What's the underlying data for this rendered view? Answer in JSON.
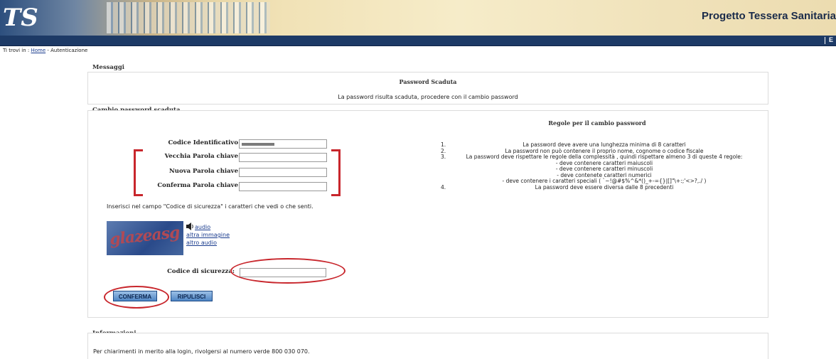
{
  "header": {
    "logo_text": "TS",
    "title": "Progetto Tessera Sanitaria",
    "nav_letter": "E"
  },
  "breadcrumb": {
    "prefix": "Ti trovi in : ",
    "home_link": "Home",
    "current": " - Autenticazione"
  },
  "messages": {
    "section_title": "Messaggi",
    "heading": "Password Scaduta",
    "text": "La password risulta scaduta, procedere con il cambio password"
  },
  "change_password": {
    "section_title": "Cambio password scaduta",
    "fields": {
      "codice_label": "Codice Identificativo",
      "vecchia_label": "Vecchia Parola chiave",
      "nuova_label": "Nuova Parola chiave",
      "conferma_label": "Conferma Parola chiave"
    },
    "captcha_instruction": "Inserisci nel campo \"Codice di sicurezza\" i caratteri che vedi o che senti.",
    "captcha_image_text": "glazeasg",
    "audio_link": "audio",
    "altra_immagine_link": "altra immagine",
    "altro_audio_link": "altro audio",
    "security_code_label": "Codice di sicurezza:",
    "confirm_button": "CONFERMA",
    "clear_button": "RIPULISCI"
  },
  "rules": {
    "title": "Regole per il cambio password",
    "items": [
      {
        "num": "1.",
        "text": "La password deve avere una lunghezza minima di 8 caratteri"
      },
      {
        "num": "2.",
        "text": "La password non può contenere il proprio nome, cognome o codice fiscale"
      },
      {
        "num": "3.",
        "text": "La password deve rispettare le regole della complessità , quindi rispettare almeno 3 di queste 4 regole:"
      },
      {
        "num": "",
        "text": "- deve contenere caratteri maiuscoli"
      },
      {
        "num": "",
        "text": "- deve contenere caratteri minuscoli"
      },
      {
        "num": "",
        "text": "- deve contenete caratteri numerici"
      },
      {
        "num": "",
        "text": "- deve contenere i caratteri speciali ( `~!@#$%^&*()_+-={}|[]\"\\+:;'<>?,./ )"
      },
      {
        "num": "4.",
        "text": "La password deve essere diversa dalle 8 precedenti"
      }
    ]
  },
  "info": {
    "section_title": "Informazioni",
    "text": "Per chiarimenti in merito alla login, rivolgersi al numero verde 800 030 070."
  },
  "colors": {
    "annotation_red": "#c8262c",
    "navbar": "#1d3a66",
    "link": "#1a3c8e"
  }
}
